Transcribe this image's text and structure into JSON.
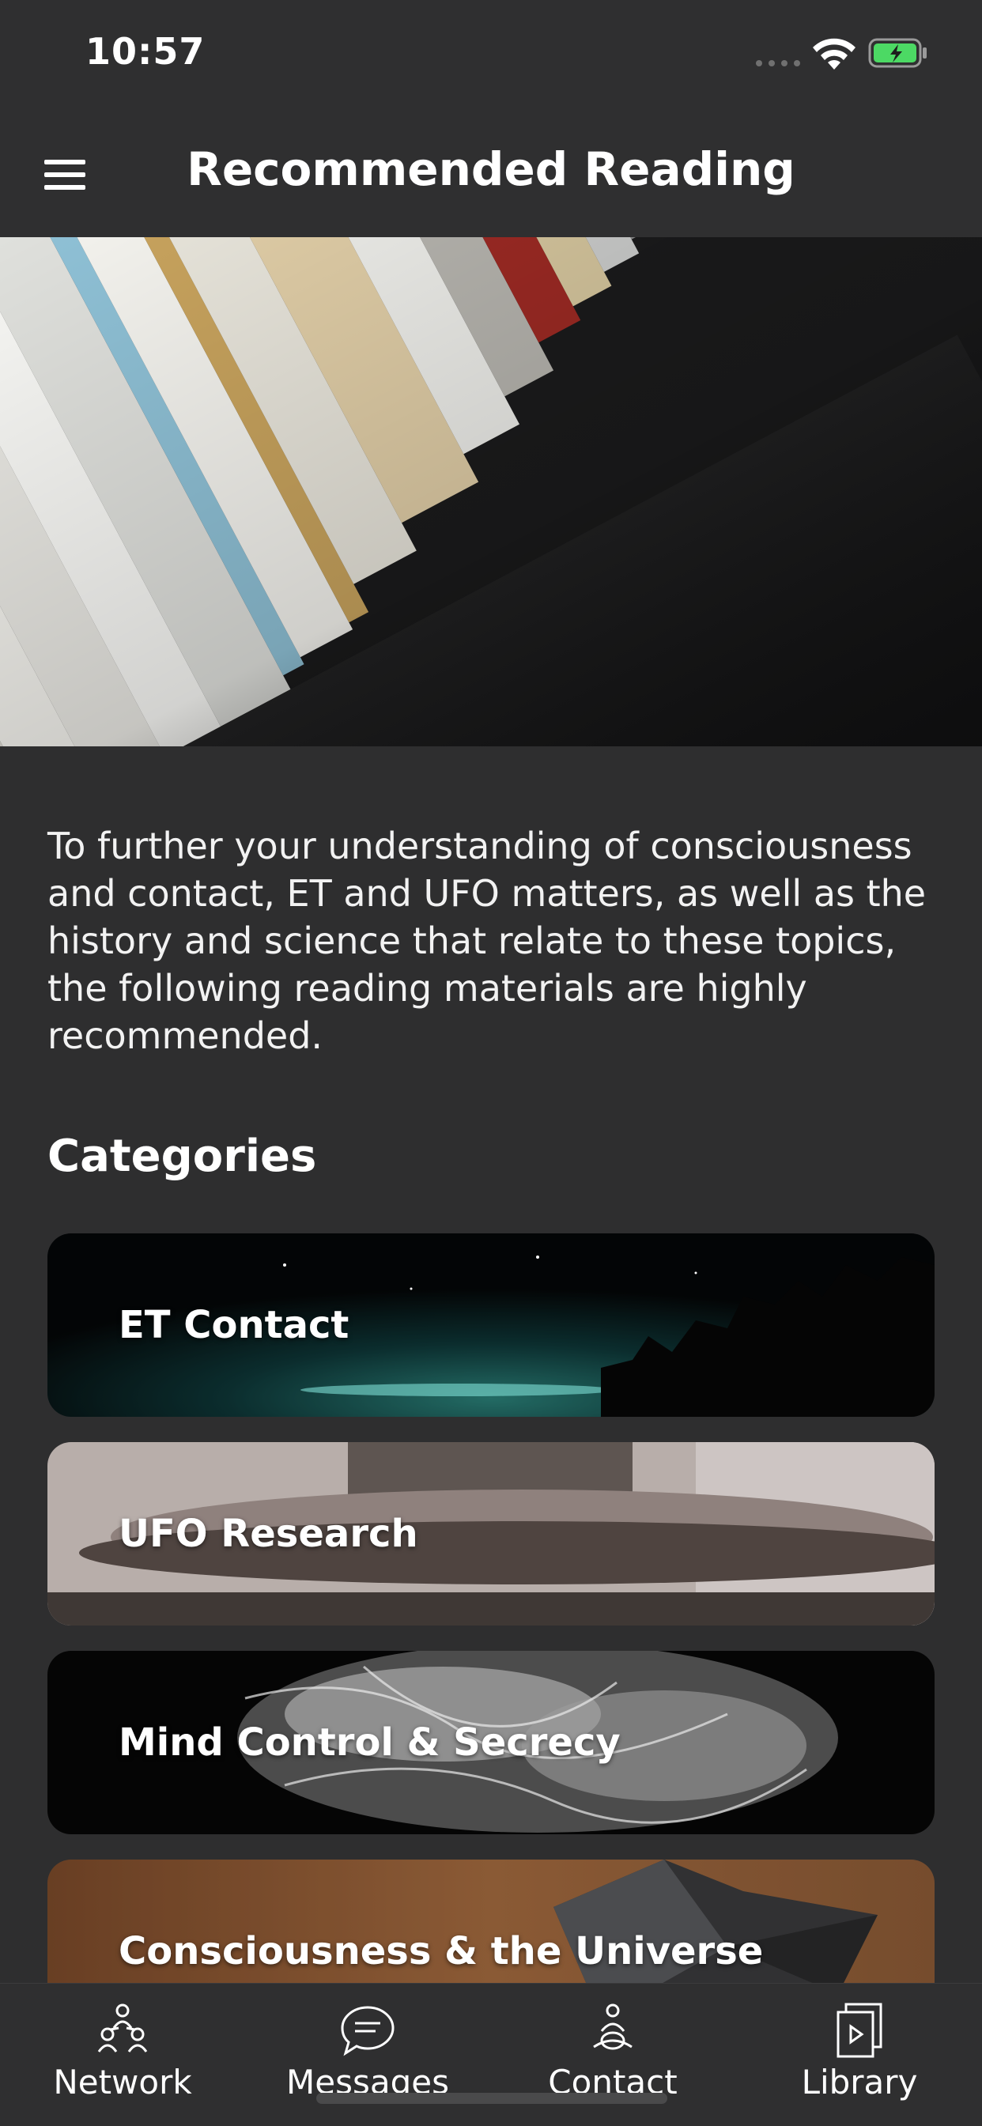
{
  "status_bar": {
    "time": "10:57"
  },
  "header": {
    "title": "Recommended Reading"
  },
  "intro": {
    "text": "To further your understanding of consciousness and contact, ET and UFO matters, as well as the history and science that relate to these topics, the following reading materials are highly recommended."
  },
  "categories": {
    "heading": "Categories",
    "items": [
      {
        "label": "ET Contact"
      },
      {
        "label": "UFO Research"
      },
      {
        "label": "Mind Control & Secrecy"
      },
      {
        "label": "Consciousness & the Universe"
      }
    ]
  },
  "tabs": [
    {
      "label": "Network",
      "icon": "network-icon"
    },
    {
      "label": "Messages",
      "icon": "messages-icon"
    },
    {
      "label": "Contact",
      "icon": "contact-icon"
    },
    {
      "label": "Library",
      "icon": "library-icon"
    }
  ],
  "colors": {
    "background": "#2e2e2f",
    "bar": "#2f2f30",
    "battery_green": "#4cd964"
  }
}
